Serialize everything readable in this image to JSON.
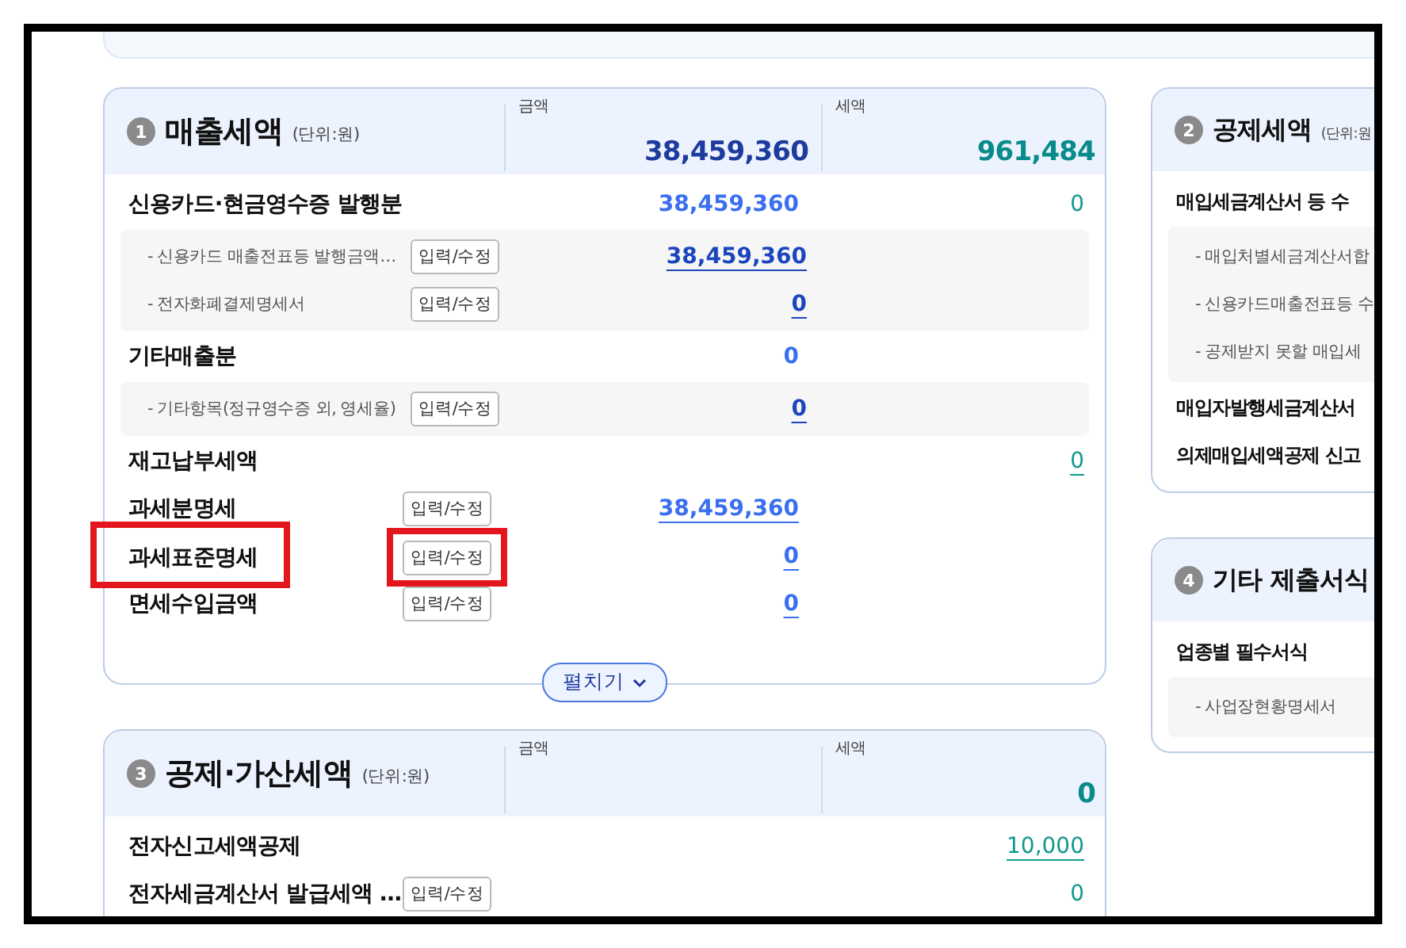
{
  "left_column": {
    "sections": [
      {
        "number": "1",
        "title": "매출세액",
        "unit": "(단위:원)",
        "amount_label": "금액",
        "amount": "38,459,360",
        "tax_label": "세액",
        "tax": "961,484",
        "expand_button": "펼치기",
        "rows": [
          {
            "kind": "main",
            "label": "신용카드·현금영수증 발행분",
            "amount": {
              "text": "38,459,360",
              "link": false
            },
            "tax": {
              "text": "0",
              "link": false
            },
            "highlighted": false
          },
          {
            "kind": "group",
            "items": [
              {
                "label": "- 신용카드 매출전표등 발행금액…",
                "button": "입력/수정",
                "amount": {
                  "text": "38,459,360",
                  "link": true
                }
              },
              {
                "label": "- 전자화폐결제명세서",
                "button": "입력/수정",
                "amount": {
                  "text": "0",
                  "link": true
                }
              }
            ]
          },
          {
            "kind": "main",
            "label": "기타매출분",
            "amount": {
              "text": "0",
              "link": false
            },
            "highlighted": false
          },
          {
            "kind": "group",
            "items": [
              {
                "label": "- 기타항목(정규영수증 외, 영세율)",
                "button": "입력/수정",
                "amount": {
                  "text": "0",
                  "link": true
                }
              }
            ]
          },
          {
            "kind": "main",
            "label": "재고납부세액",
            "tax": {
              "text": "0",
              "link": true
            },
            "highlighted": false
          },
          {
            "kind": "main",
            "label": "과세분명세",
            "button": "입력/수정",
            "amount": {
              "text": "38,459,360",
              "link": true
            },
            "highlighted": false
          },
          {
            "kind": "main",
            "label": "과세표준명세",
            "button": "입력/수정",
            "amount": {
              "text": "0",
              "link": true
            },
            "highlighted": true
          },
          {
            "kind": "main",
            "label": "면세수입금액",
            "button": "입력/수정",
            "amount": {
              "text": "0",
              "link": true
            },
            "highlighted": false
          }
        ]
      },
      {
        "number": "3",
        "title": "공제·가산세액",
        "unit": "(단위:원)",
        "amount_label": "금액",
        "tax_label": "세액",
        "tax": "0",
        "rows": [
          {
            "kind": "main",
            "label": "전자신고세액공제",
            "tax": {
              "text": "10,000",
              "link": true
            },
            "highlighted": false
          },
          {
            "kind": "main",
            "label": "전자세금계산서 발급세액 …",
            "button": "입력/수정",
            "tax": {
              "text": "0",
              "link": false
            },
            "highlighted": false
          }
        ]
      }
    ]
  },
  "right_column": {
    "sections": [
      {
        "number": "2",
        "title": "공제세액",
        "unit": "(단위:원",
        "rows": [
          {
            "kind": "main",
            "label": "매입세금계산서 등 수",
            "highlighted": false
          },
          {
            "kind": "group",
            "items": [
              {
                "label": "- 매입처별세금계산서합"
              },
              {
                "label": "- 신용카드매출전표등 수"
              },
              {
                "label": "- 공제받지 못할 매입세"
              }
            ]
          },
          {
            "kind": "main",
            "label": "매입자발행세금계산서",
            "highlighted": false
          },
          {
            "kind": "main",
            "label": "의제매입세액공제 신고",
            "highlighted": false
          }
        ]
      },
      {
        "number": "4",
        "title": "기타 제출서식",
        "rows": [
          {
            "kind": "main",
            "label": "업종별 필수서식",
            "highlighted": false
          },
          {
            "kind": "group",
            "items": [
              {
                "label": "- 사업장현황명세서"
              }
            ]
          }
        ]
      }
    ]
  }
}
